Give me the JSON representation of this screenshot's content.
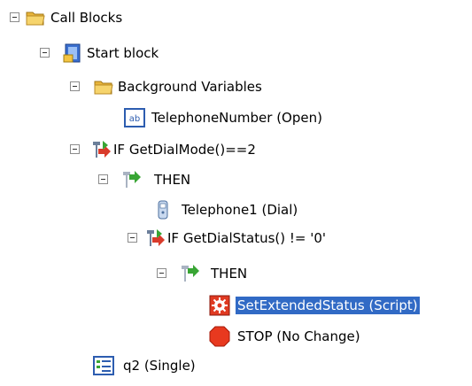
{
  "tree": {
    "call_blocks": "Call Blocks",
    "start_block": "Start block",
    "background_variables": "Background Variables",
    "telephone_number": "TelephoneNumber (Open)",
    "if_dial_mode": "IF GetDialMode()==2",
    "then_1": "THEN",
    "telephone1": "Telephone1 (Dial)",
    "if_dial_status": "IF GetDialStatus() != '0'",
    "then_2": "THEN",
    "set_extended_status": "SetExtendedStatus (Script)",
    "stop": "STOP (No Change)",
    "q2": "q2 (Single)"
  },
  "selection": {
    "selected_item": "set_extended_status",
    "highlight_color": "#316ac5"
  }
}
